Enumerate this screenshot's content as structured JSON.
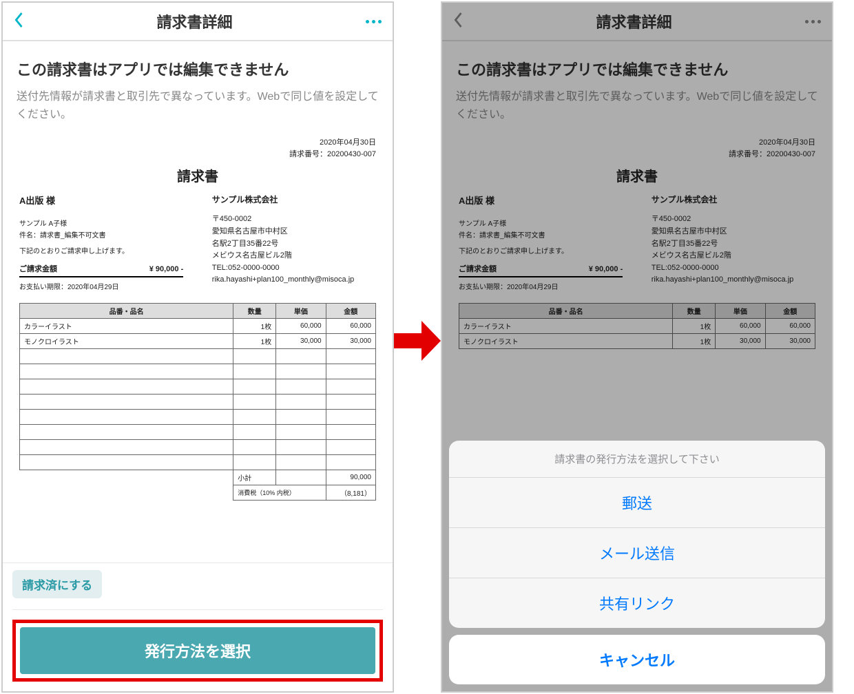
{
  "header": {
    "title": "請求書詳細"
  },
  "warning": {
    "title": "この請求書はアプリでは編集できません",
    "text": "送付先情報が請求書と取引先で異なっています。Webで同じ値を設定してください。"
  },
  "invoice": {
    "date": "2020年04月30日",
    "number_label": "請求番号",
    "number": "20200430-007",
    "title": "請求書",
    "client_name": "A出版 様",
    "contact_name": "サンプル A子様",
    "subject_label": "件名",
    "subject": "請求書_編集不可文書",
    "intro": "下記のとおりご請求申し上げます。",
    "total_label": "ご請求金額",
    "total_amount": "¥ 90,000 -",
    "due_label": "お支払い期限",
    "due_date": "2020年04月29日",
    "supplier_name": "サンプル株式会社",
    "postal": "〒450-0002",
    "address1": "愛知県名古屋市中村区",
    "address2": "名駅2丁目35番22号",
    "address3": "メビウス名古屋ビル2階",
    "tel_label": "TEL",
    "tel": "052-0000-0000",
    "email": "rika.hayashi+plan100_monthly@misoca.jp",
    "columns": {
      "name": "品番・品名",
      "qty": "数量",
      "unit_price": "単価",
      "amount": "金額"
    },
    "items": [
      {
        "name": "カラーイラスト",
        "qty": "1枚",
        "unit_price": "60,000",
        "amount": "60,000"
      },
      {
        "name": "モノクロイラスト",
        "qty": "1枚",
        "unit_price": "30,000",
        "amount": "30,000"
      }
    ],
    "empty_rows": 8,
    "subtotal_label": "小計",
    "subtotal": "90,000",
    "tax_label": "消費税（10% 内税）",
    "tax": "（8,181）"
  },
  "footer": {
    "mark_invoiced": "請求済にする",
    "primary_cta": "発行方法を選択"
  },
  "action_sheet": {
    "title": "請求書の発行方法を選択して下さい",
    "options": [
      "郵送",
      "メール送信",
      "共有リンク"
    ],
    "cancel": "キャンセル"
  }
}
